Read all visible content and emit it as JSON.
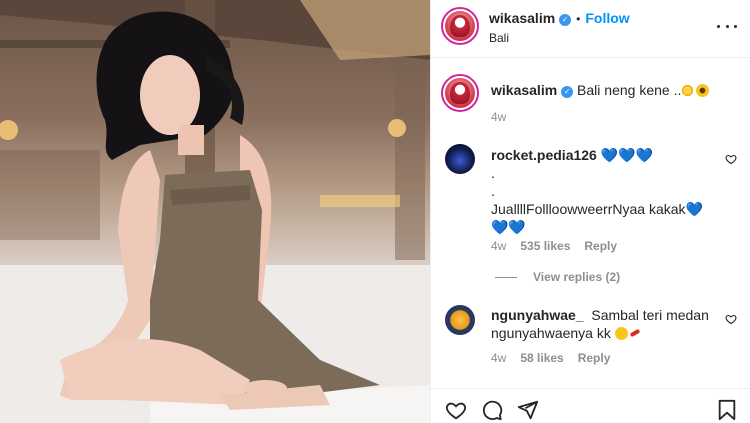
{
  "post": {
    "username": "wikasalim",
    "follow_label": "Follow",
    "location": "Bali",
    "caption_username": "wikasalim",
    "caption_text": "Bali neng kene ..",
    "caption_time": "4w"
  },
  "comments": [
    {
      "username": "rocket.pedia126",
      "lines": [
        ".",
        ".",
        "JuallllFollloowweerrNyaa kakak"
      ],
      "time": "4w",
      "likes": "535 likes",
      "reply_label": "Reply",
      "view_replies": "View replies (2)"
    },
    {
      "username": "ngunyahwae_",
      "text_line1": "Sambal teri medan",
      "text_line2": "ngunyahwaenya kk",
      "time": "4w",
      "likes": "58 likes",
      "reply_label": "Reply"
    }
  ],
  "colors": {
    "accent": "#0095f6",
    "verified": "#3897f0",
    "secondary_text": "#8e8e8e",
    "heart_emoji": "#1da1f2"
  },
  "icons": [
    "more-options-icon",
    "verified-badge-icon",
    "heart-icon",
    "comment-icon",
    "share-icon",
    "bookmark-icon"
  ]
}
